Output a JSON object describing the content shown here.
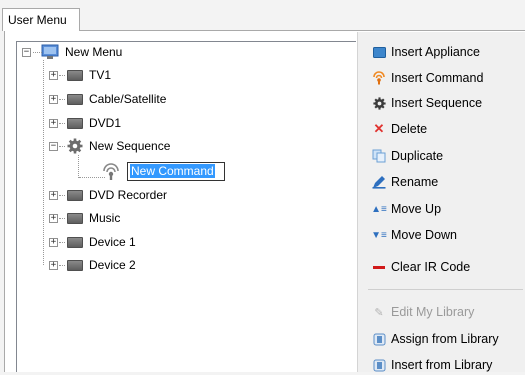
{
  "tabs": [
    {
      "label": "User Menu"
    }
  ],
  "tree": {
    "root": {
      "label": "New Menu",
      "expander": "⊟"
    },
    "items": [
      {
        "label": "TV1",
        "expander": "+"
      },
      {
        "label": "Cable/Satellite",
        "expander": "+"
      },
      {
        "label": "DVD1",
        "expander": "+"
      },
      {
        "label": "New Sequence",
        "expander": "−"
      },
      {
        "label": "DVD Recorder",
        "expander": "+"
      },
      {
        "label": "Music",
        "expander": "+"
      },
      {
        "label": "Device 1",
        "expander": "+"
      },
      {
        "label": "Device 2",
        "expander": "+"
      }
    ],
    "editing": {
      "value": "New Command"
    }
  },
  "actions": [
    {
      "label": "Insert Appliance",
      "icon": "appliance-icon",
      "enabled": true
    },
    {
      "label": "Insert Command",
      "icon": "command-icon",
      "enabled": true
    },
    {
      "label": "Insert Sequence",
      "icon": "gear-icon",
      "enabled": true
    },
    {
      "label": "Delete",
      "icon": "delete-icon",
      "enabled": true
    },
    {
      "label": "Duplicate",
      "icon": "duplicate-icon",
      "enabled": true
    },
    {
      "label": "Rename",
      "icon": "rename-icon",
      "enabled": true
    },
    {
      "label": "Move Up",
      "icon": "move-up-icon",
      "enabled": true
    },
    {
      "label": "Move Down",
      "icon": "move-down-icon",
      "enabled": true
    },
    {
      "label": "Clear IR Code",
      "icon": "clear-ir-icon",
      "enabled": true
    },
    {
      "label": "Edit My Library",
      "icon": "pencil-icon",
      "enabled": false
    },
    {
      "label": "Assign from Library",
      "icon": "library-icon",
      "enabled": true
    },
    {
      "label": "Insert from Library",
      "icon": "library-insert-icon",
      "enabled": true
    }
  ],
  "colors": {
    "selection": "#3399ff",
    "delete": "#e0322f",
    "clear": "#d11a1a"
  }
}
